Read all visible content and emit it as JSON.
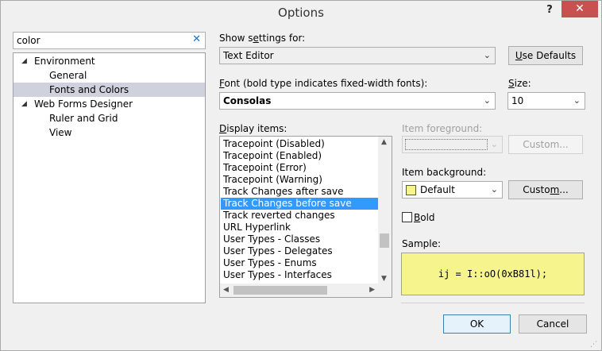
{
  "window": {
    "title": "Options",
    "help": "?",
    "close": "✕"
  },
  "search": {
    "value": "color",
    "clear": "✕"
  },
  "tree": {
    "env": "Environment",
    "general": "General",
    "fonts": "Fonts and Colors",
    "webforms": "Web Forms Designer",
    "ruler": "Ruler and Grid",
    "view": "View"
  },
  "settings": {
    "show_pre": "Show s",
    "show_u": "e",
    "show_post": "ttings for:",
    "show_value": "Text Editor",
    "use_pre": "",
    "use_u": "U",
    "use_post": "se Defaults",
    "font_pre": "",
    "font_u": "F",
    "font_post": "ont (bold type indicates fixed-width fonts):",
    "font_value": "Consolas",
    "size_pre": "",
    "size_u": "S",
    "size_post": "ize:",
    "size_value": "10",
    "display_pre": "",
    "display_u": "D",
    "display_post": "isplay items:",
    "fg_label": "Item foreground:",
    "fg_custom": "Custom...",
    "bg_label": "Item background:",
    "bg_value": "Default",
    "bg_custom_pre": "Custo",
    "bg_custom_u": "m",
    "bg_custom_post": "...",
    "bold_pre": "",
    "bold_u": "B",
    "bold_post": "old",
    "sample_label": "Sample:",
    "sample_text": "ij = I::oO(0xB81l);"
  },
  "display_items": [
    "Tracepoint (Disabled)",
    "Tracepoint (Enabled)",
    "Tracepoint (Error)",
    "Tracepoint (Warning)",
    "Track Changes after save",
    "Track Changes before save",
    "Track reverted changes",
    "URL Hyperlink",
    "User Types - Classes",
    "User Types - Delegates",
    "User Types - Enums",
    "User Types - Interfaces"
  ],
  "selected_display_item": 5,
  "colors": {
    "bg_swatch": "#f6f48c",
    "selection": "#3399ff",
    "sample_bg": "#f6f48c"
  },
  "buttons": {
    "ok": "OK",
    "cancel": "Cancel"
  }
}
